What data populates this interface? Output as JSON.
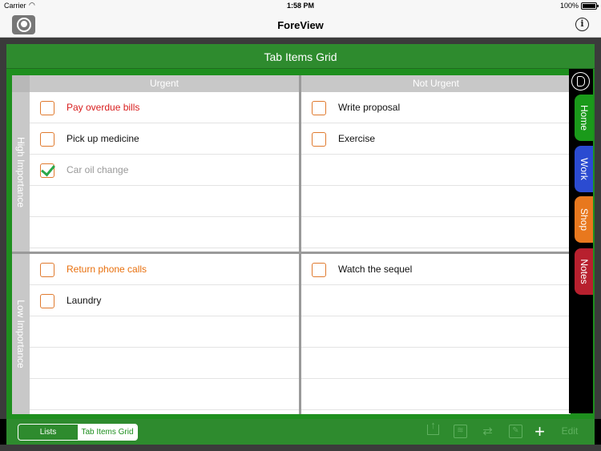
{
  "status": {
    "carrier": "Carrier",
    "time": "1:58 PM",
    "battery": "100%"
  },
  "nav": {
    "title": "ForeView",
    "info_glyph": "i"
  },
  "panel": {
    "title": "Tab Items Grid"
  },
  "grid": {
    "col_headers": [
      "Urgent",
      "Not Urgent"
    ],
    "row_headers": [
      "High Importance",
      "Low Importance"
    ],
    "quadrants": {
      "high_urgent": [
        {
          "label": "Pay overdue bills",
          "checked": false,
          "color": "red"
        },
        {
          "label": "Pick up medicine",
          "checked": false,
          "color": "black"
        },
        {
          "label": "Car oil change",
          "checked": true,
          "color": "gray"
        }
      ],
      "high_not_urgent": [
        {
          "label": "Write proposal",
          "checked": false,
          "color": "black"
        },
        {
          "label": "Exercise",
          "checked": false,
          "color": "black"
        }
      ],
      "low_urgent": [
        {
          "label": "Return phone calls",
          "checked": false,
          "color": "orange"
        },
        {
          "label": "Laundry",
          "checked": false,
          "color": "black"
        }
      ],
      "low_not_urgent": [
        {
          "label": "Watch the sequel",
          "checked": false,
          "color": "black"
        }
      ]
    }
  },
  "tabs": [
    {
      "label": "Home",
      "color": "#1a9a1a"
    },
    {
      "label": "Work",
      "color": "#2b4bd1"
    },
    {
      "label": "Shop",
      "color": "#e8781e"
    },
    {
      "label": "Notes",
      "color": "#b8202e"
    }
  ],
  "toolbar": {
    "segments": [
      "Lists",
      "Tab Items Grid"
    ],
    "active_segment": "Tab Items Grid",
    "icons": [
      "share-icon",
      "folder-icon",
      "swap-icon",
      "compose-icon",
      "plus-icon"
    ],
    "edit_label": "Edit",
    "plus_glyph": "+"
  },
  "colors": {
    "accent_green": "#2e8b2e",
    "urgent_red": "#d81e1e",
    "orange": "#e8700e",
    "check_green": "#2aa84a"
  }
}
